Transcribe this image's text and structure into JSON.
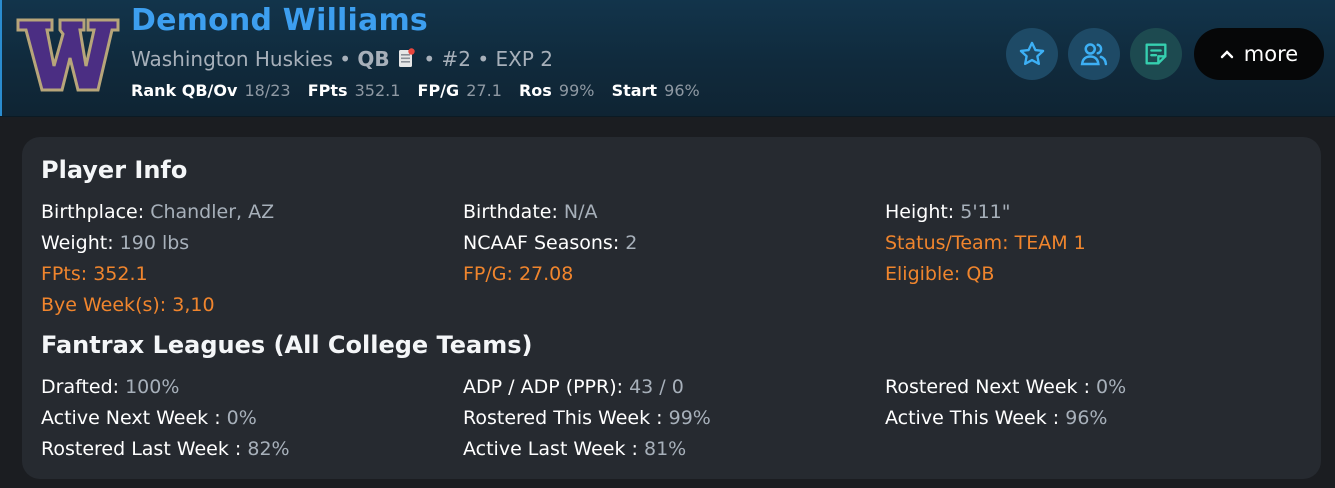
{
  "header": {
    "player_name": "Demond Williams",
    "team": "Washington Huskies",
    "sep1": "•",
    "position": "QB",
    "sep2": "•",
    "depth": "#2",
    "sep3": "•",
    "exp": "EXP 2",
    "logo_letter": "W",
    "colors": {
      "name": "#3d9ff0",
      "logo_purple": "#4b2e83",
      "logo_gold": "#b7a57a"
    },
    "stats": [
      {
        "label": "Rank QB/Ov",
        "value": "18/23"
      },
      {
        "label": "FPts",
        "value": "352.1"
      },
      {
        "label": "FP/G",
        "value": "27.1"
      },
      {
        "label": "Ros",
        "value": "99%"
      },
      {
        "label": "Start",
        "value": "96%"
      }
    ],
    "actions": {
      "star_icon": "star-icon",
      "users_icon": "users-icon",
      "notes_icon": "notes-icon",
      "more_label": "more"
    }
  },
  "player_info": {
    "title": "Player Info",
    "fields": [
      {
        "label": "Birthplace:",
        "value": "Chandler, AZ"
      },
      {
        "label": "Birthdate:",
        "value": "N/A"
      },
      {
        "label": "Height:",
        "value": "5'11\""
      },
      {
        "label": "Weight:",
        "value": "190 lbs"
      },
      {
        "label": "NCAAF Seasons:",
        "value": "2"
      },
      {
        "label": "Status/Team:",
        "value": "TEAM 1"
      },
      {
        "label": "FPts:",
        "value": "352.1"
      },
      {
        "label": "FP/G:",
        "value": "27.08"
      },
      {
        "label": "Eligible:",
        "value": "QB"
      },
      {
        "label": "Bye Week(s):",
        "value": "3,10"
      }
    ]
  },
  "fantrax": {
    "title": "Fantrax Leagues (All College Teams)",
    "fields": [
      {
        "label": "Drafted:",
        "value": "100%"
      },
      {
        "label": "ADP / ADP (PPR):",
        "value": "43 / 0"
      },
      {
        "label": "Rostered Next Week :",
        "value": "0%"
      },
      {
        "label": "Active Next Week :",
        "value": "0%"
      },
      {
        "label": "Rostered This Week :",
        "value": "99%"
      },
      {
        "label": "Active This Week :",
        "value": "96%"
      },
      {
        "label": "Rostered Last Week :",
        "value": "82%"
      },
      {
        "label": "Active Last Week :",
        "value": "81%"
      }
    ]
  },
  "accent_colors": {
    "orange": "#f0852d",
    "muted": "#a7b0ba"
  }
}
